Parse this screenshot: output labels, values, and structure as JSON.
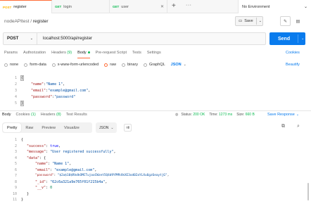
{
  "tabs": [
    {
      "method": "POST",
      "label": "register",
      "active": true
    },
    {
      "method": "GET",
      "label": "login",
      "active": false
    },
    {
      "method": "GET",
      "label": "user",
      "active": false
    }
  ],
  "environment": {
    "label": "No Environment"
  },
  "breadcrumb": {
    "collection": "nodeAPItest",
    "separator": "/",
    "request": "register"
  },
  "toolbar": {
    "save_label": "Save"
  },
  "request": {
    "method": "POST",
    "url": "localhost:5000/api/register",
    "send_label": "Send"
  },
  "request_tabs": {
    "params": "Params",
    "authorization": "Authorization",
    "headers": "Headers",
    "headers_count": "(9)",
    "body": "Body",
    "prerequest": "Pre-request Script",
    "tests": "Tests",
    "settings": "Settings",
    "cookies": "Cookies"
  },
  "body_types": {
    "none": "none",
    "form_data": "form-data",
    "urlencoded": "x-www-form-urlencoded",
    "raw": "raw",
    "binary": "binary",
    "graphql": "GraphQL",
    "format": "JSON",
    "beautify": "Beautify"
  },
  "request_body": {
    "line_numbers": [
      "1",
      "2",
      "3",
      "4",
      "5"
    ],
    "open": "{",
    "close": "}",
    "fields": [
      {
        "key": "\"name\"",
        "value": "\"Name 1\"",
        "comma": ","
      },
      {
        "key": "\"email\"",
        "value": "\"example@gmail.com\"",
        "comma": ","
      },
      {
        "key": "\"password\"",
        "value": "\"password\"",
        "comma": ""
      }
    ]
  },
  "response_tabs": {
    "body": "Body",
    "cookies": "Cookies",
    "cookies_count": "(1)",
    "headers": "Headers",
    "headers_count": "(8)",
    "test_results": "Test Results"
  },
  "response_status": {
    "status_label": "Status:",
    "status_value": "200 OK",
    "time_label": "Time:",
    "time_value": "1273 ms",
    "size_label": "Size:",
    "size_value": "660 B",
    "save_response": "Save Response"
  },
  "response_view": {
    "pretty": "Pretty",
    "raw": "Raw",
    "preview": "Preview",
    "visualize": "Visualize",
    "format": "JSON"
  },
  "response_body": {
    "line_numbers": [
      "1",
      "2",
      "3",
      "4",
      "5",
      "6",
      "7",
      "8",
      "9",
      "10",
      "11"
    ],
    "l1": "{",
    "success_key": "\"success\"",
    "success_val": "true",
    "message_key": "\"message\"",
    "message_val": "\"User registered successfully\"",
    "data_key": "\"data\"",
    "data_open": "{",
    "name_key": "\"name\"",
    "name_val": "\"Name 1\"",
    "email_key": "\"email\"",
    "email_val": "\"example@gmail.com\"",
    "password_key": "\"password\"",
    "password_val": "\"$2a$10$RhdkOMCTujooCWzet5Q4d9YPMhXkXE3od02aYLXu6gz6eaytjG\"",
    "id_key": "\"_id\"",
    "id_val": "\"62c6a321a9e765f01f215b4a\"",
    "v_key": "\"__v\"",
    "v_val": "0",
    "data_close": "}",
    "l11": "}"
  },
  "colors": {
    "accent": "#ff6c37",
    "send": "#097bed",
    "get": "#0cbb52",
    "post": "#ffb400"
  }
}
